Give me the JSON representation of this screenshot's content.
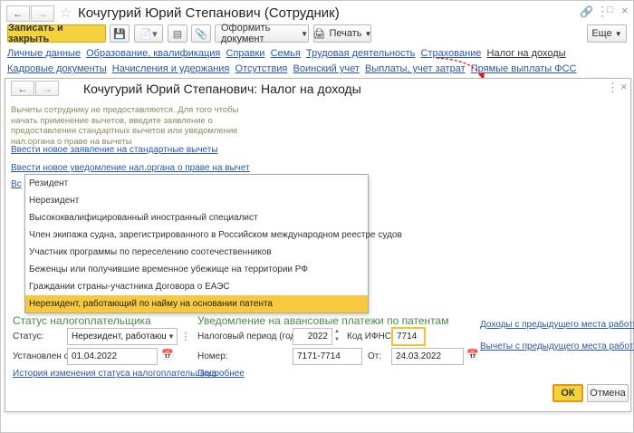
{
  "outer": {
    "title": "Кочугурий Юрий Степанович (Сотрудник)",
    "save_close": "Записать и закрыть",
    "oformit": "Оформить документ",
    "print": "Печать",
    "eshche": "Еще",
    "tabs_row1": [
      "Личные данные",
      "Образование, квалификация",
      "Справки",
      "Семья",
      "Трудовая деятельность",
      "Страхование",
      "Налог на доходы"
    ],
    "tabs_row2": [
      "Кадровые документы",
      "Начисления и удержания",
      "Отсутствия",
      "Воинский учет",
      "Выплаты, учет затрат",
      "Прямые выплаты ФСС"
    ]
  },
  "inner": {
    "title": "Кочугурий Юрий Степанович: Налог на доходы",
    "info_lines": [
      "Вычеты сотруднику не предоставляются. Для того чтобы",
      "начать применение вычетов, введите заявление о",
      "предоставлении стандартных вычетов или уведомление",
      "нал.органа о праве на вычеты"
    ],
    "link_application": "Ввести новое заявление на стандартные вычеты",
    "link_notification": "Ввести новое уведомление нал.органа о праве на вычет",
    "link_partial": "Вс",
    "dropdown": [
      "Резидент",
      "Нерезидент",
      "Высококвалифицированный иностранный специалист",
      "Член экипажа судна, зарегистрированного в Российском международном реестре судов",
      "Участник программы по переселению соотечественников",
      "Беженцы или получившие временное убежище на территории РФ",
      "Граждании страны-участника Договора о ЕАЭС",
      "Нерезидент, работающий по найму на основании патента"
    ],
    "status_section": "Статус налогоплательщика",
    "status_label": "Статус:",
    "status_value": "Нерезидент, работающий",
    "established_label": "Установлен с:",
    "established_value": "01.04.2022",
    "history_link": "История изменения статуса налогоплательщика",
    "notice_section": "Уведомление на авансовые платежи по патентам",
    "period_label": "Налоговый период (год):",
    "period_value": "2022",
    "ifns_label": "Код ИФНС:",
    "ifns_value": "7714",
    "number_label": "Номер:",
    "number_value": "7171-7714",
    "from_label": "От:",
    "from_value": "24.03.2022",
    "details_link": "Подробнее",
    "income_prev_link": "Доходы с предыдущего места работы",
    "deductions_prev_link": "Вычеты с предыдущего места работы",
    "ok": "ОК",
    "cancel": "Отмена"
  },
  "colors": {
    "accent_yellow": "#f4d23c",
    "link": "#2a56a8",
    "highlight": "#f7c93e"
  }
}
